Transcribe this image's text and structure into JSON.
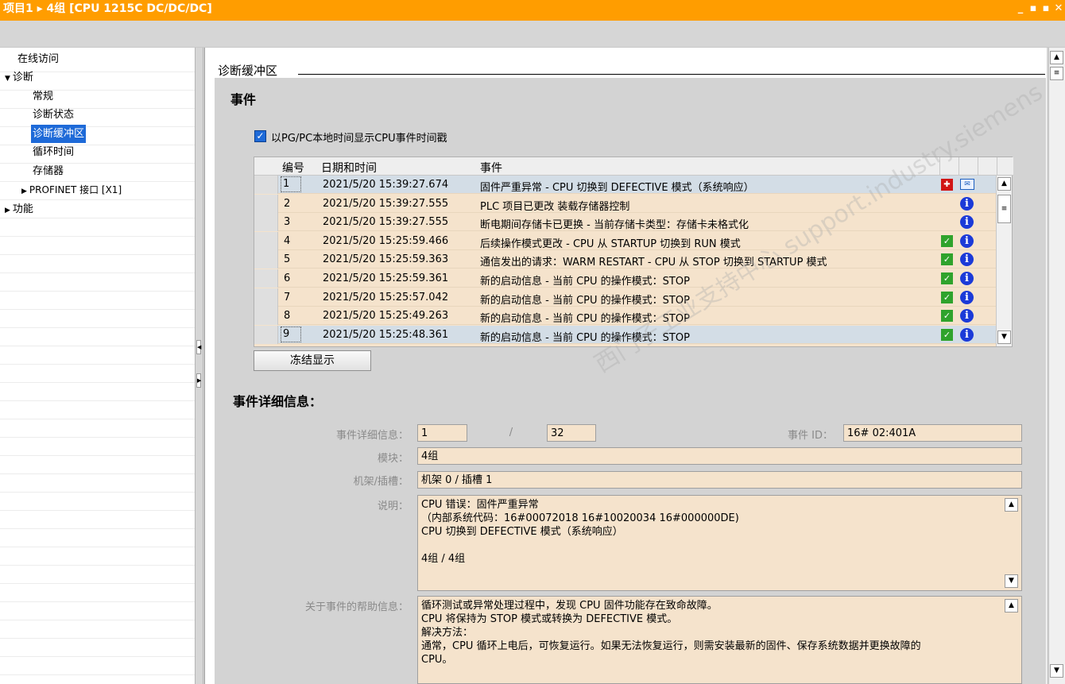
{
  "window": {
    "title": "项目1 ▸ 4组 [CPU 1215C DC/DC/DC]",
    "controls": [
      "_",
      "▪",
      "▪",
      "✕"
    ]
  },
  "nav": {
    "items": [
      {
        "label": "在线访问",
        "level": 0,
        "arrow": ""
      },
      {
        "label": "诊断",
        "level": 0,
        "arrow": "▼"
      },
      {
        "label": "常规",
        "level": 1,
        "arrow": ""
      },
      {
        "label": "诊断状态",
        "level": 1,
        "arrow": ""
      },
      {
        "label": "诊断缓冲区",
        "level": 1,
        "arrow": "",
        "selected": true
      },
      {
        "label": "循环时间",
        "level": 1,
        "arrow": ""
      },
      {
        "label": "存储器",
        "level": 1,
        "arrow": ""
      },
      {
        "label": "PROFINET 接口 [X1]",
        "level": 1,
        "arrow": "▶"
      },
      {
        "label": "功能",
        "level": 0,
        "arrow": "▶"
      }
    ]
  },
  "main": {
    "section_label": "诊断缓冲区",
    "events_heading": "事件",
    "checkbox_label": "以PG/PC本地时间显示CPU事件时间戳",
    "table": {
      "headers": {
        "no": "编号",
        "datetime": "日期和时间",
        "event": "事件"
      },
      "rows": [
        {
          "no": "1",
          "datetime": "2021/5/20 15:39:27.674",
          "event": "固件严重异常 - CPU 切换到 DEFECTIVE 模式（系统响应）",
          "icons": [
            "err",
            "mail"
          ],
          "selected": true
        },
        {
          "no": "2",
          "datetime": "2021/5/20 15:39:27.555",
          "event": "PLC 项目已更改 装载存储器控制",
          "icons": [
            "info"
          ]
        },
        {
          "no": "3",
          "datetime": "2021/5/20 15:39:27.555",
          "event": "断电期间存储卡已更换 - 当前存储卡类型：存储卡未格式化",
          "icons": [
            "info"
          ]
        },
        {
          "no": "4",
          "datetime": "2021/5/20 15:25:59.466",
          "event": "后续操作模式更改 - CPU 从 STARTUP 切换到 RUN 模式",
          "icons": [
            "ok",
            "info"
          ]
        },
        {
          "no": "5",
          "datetime": "2021/5/20 15:25:59.363",
          "event": "通信发出的请求：WARM RESTART - CPU 从 STOP 切换到 STARTUP 模式",
          "icons": [
            "ok",
            "info"
          ]
        },
        {
          "no": "6",
          "datetime": "2021/5/20 15:25:59.361",
          "event": "新的启动信息 - 当前 CPU 的操作模式：STOP",
          "icons": [
            "ok",
            "info"
          ]
        },
        {
          "no": "7",
          "datetime": "2021/5/20 15:25:57.042",
          "event": "新的启动信息 - 当前 CPU 的操作模式：STOP",
          "icons": [
            "ok",
            "info"
          ]
        },
        {
          "no": "8",
          "datetime": "2021/5/20 15:25:49.263",
          "event": "新的启动信息 - 当前 CPU 的操作模式：STOP",
          "icons": [
            "ok",
            "info"
          ]
        },
        {
          "no": "9",
          "datetime": "2021/5/20 15:25:48.361",
          "event": "新的启动信息 - 当前 CPU 的操作模式：STOP",
          "icons": [
            "ok",
            "info"
          ],
          "highlight": true
        }
      ]
    },
    "freeze_button": "冻结显示",
    "detail": {
      "heading": "事件详细信息：",
      "index_label": "事件详细信息：",
      "index_value": "1",
      "separator": "/",
      "total_value": "32",
      "event_id_label": "事件 ID：",
      "event_id_value": "16# 02:401A",
      "module_label": "模块：",
      "module_value": "4组",
      "rack_label": "机架/插槽：",
      "rack_value": "机架 0 / 插槽 1",
      "desc_label": "说明：",
      "desc_value": "CPU 错误：固件严重异常\n（内部系统代码：16#00072018 16#10020034 16#000000DE)\nCPU 切换到 DEFECTIVE 模式（系统响应）\n\n4组 / 4组",
      "help_label": "关于事件的帮助信息：",
      "help_value": "循环测试或异常处理过程中，发现 CPU 固件功能存在致命故障。\nCPU 将保持为 STOP 模式或转换为 DEFECTIVE 模式。\n解决方法：\n通常，CPU 循环上电后，可恢复运行。如果无法恢复运行，则需安装最新的固件、保存系统数据并更换故障的\nCPU。"
    }
  },
  "watermark": "西门子工业支持中心 support.industry.siemens"
}
